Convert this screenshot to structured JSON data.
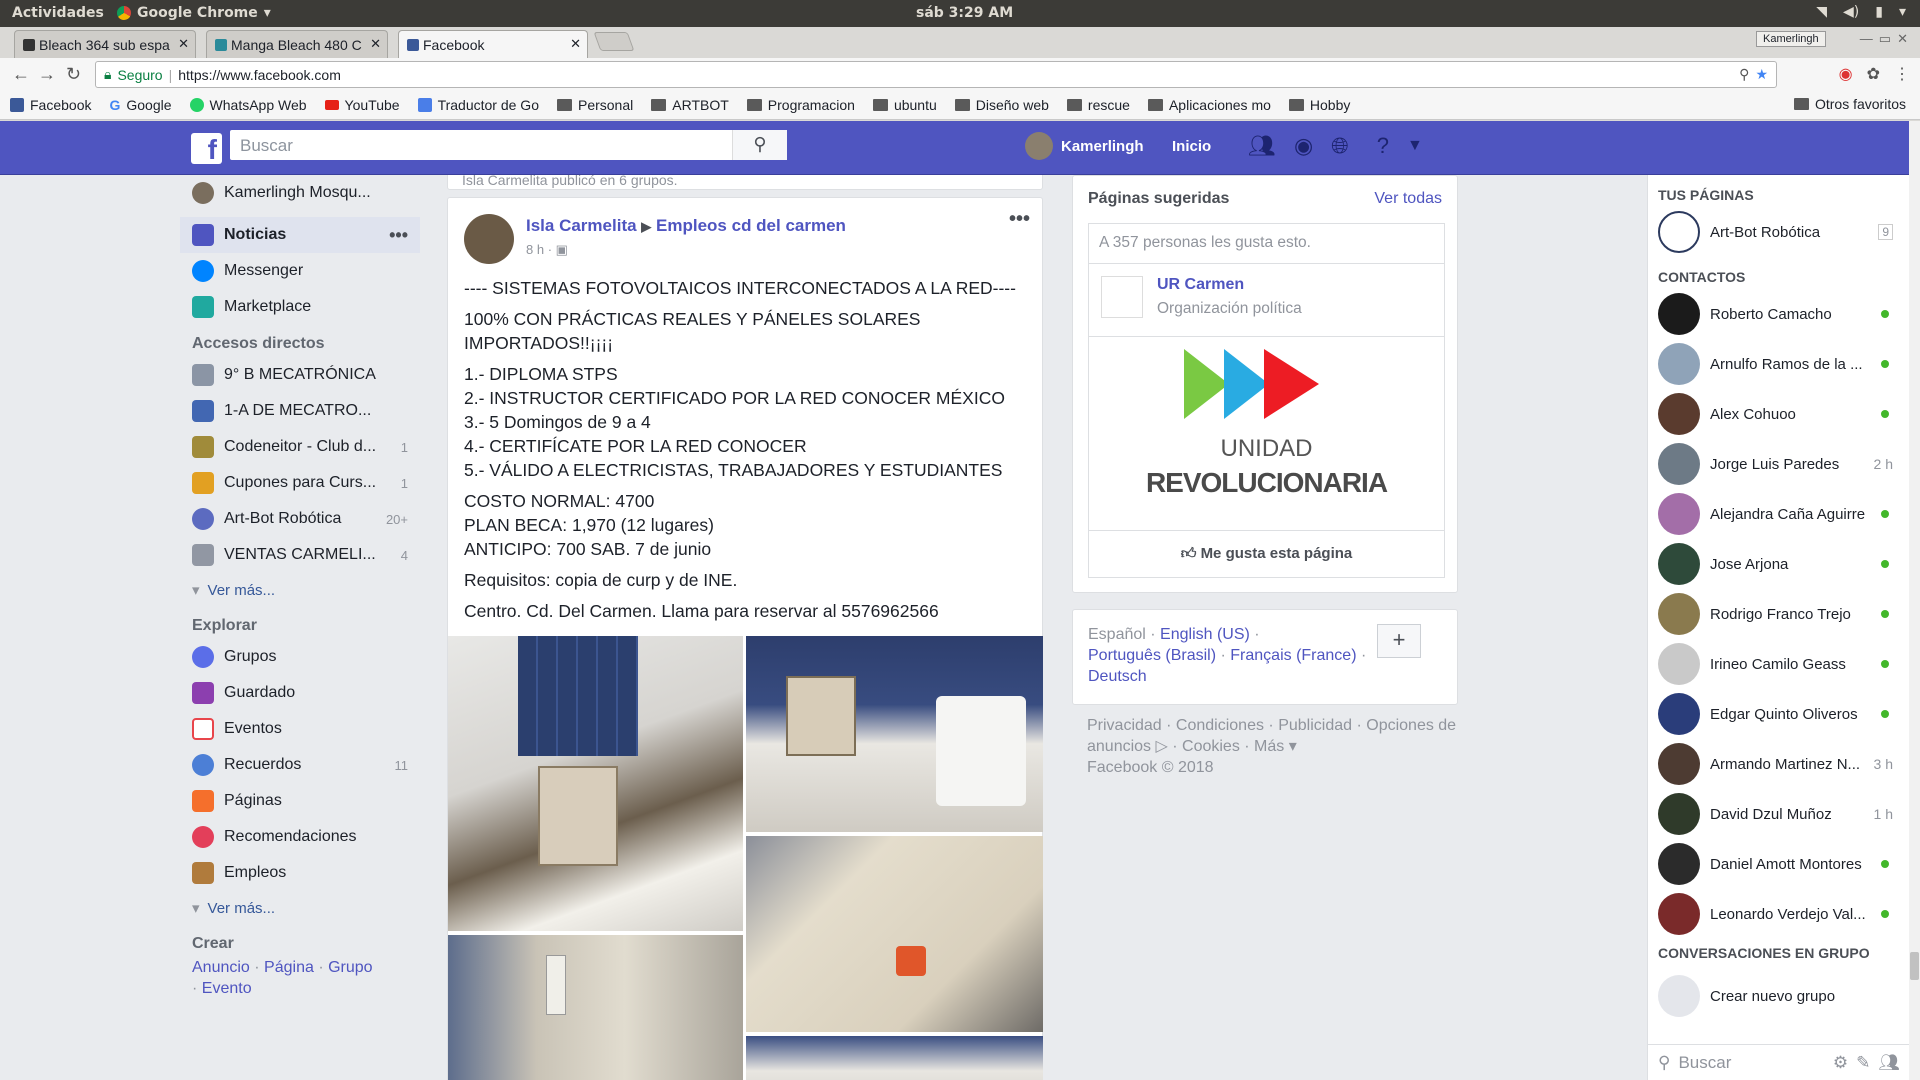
{
  "system": {
    "activities": "Actividades",
    "app": "Google Chrome",
    "clock": "sáb  3:29 AM"
  },
  "tabs": [
    {
      "label": "Bleach 364 sub espa",
      "active": false
    },
    {
      "label": "Manga Bleach 480 C",
      "active": false
    },
    {
      "label": "Facebook",
      "active": true
    }
  ],
  "profile": "Kamerlingh",
  "omnibox": {
    "secure": "Seguro",
    "url": "https://www.facebook.com"
  },
  "bookmarks": [
    "Facebook",
    "Google",
    "WhatsApp Web",
    "YouTube",
    "Traductor de Go",
    "Personal",
    "ARTBOT",
    "Programacion",
    "ubuntu",
    "Diseño web",
    "rescue",
    "Aplicaciones mo",
    "Hobby"
  ],
  "bookmarks_other": "Otros favoritos",
  "fb": {
    "search_placeholder": "Buscar",
    "user": "Kamerlingh",
    "home": "Inicio",
    "left": {
      "profile": "Kamerlingh Mosqu...",
      "news": "Noticias",
      "messenger": "Messenger",
      "marketplace": "Marketplace",
      "shortcuts_title": "Accesos directos",
      "shortcuts": [
        {
          "label": "9° B MECATRÓNICA",
          "count": ""
        },
        {
          "label": "1-A DE MECATRO...",
          "count": ""
        },
        {
          "label": "Codeneitor - Club d...",
          "count": "1"
        },
        {
          "label": "Cupones para Curs...",
          "count": "1"
        },
        {
          "label": "Art-Bot Robótica",
          "count": "20+"
        },
        {
          "label": "VENTAS CARMELI...",
          "count": "4"
        }
      ],
      "more": "Ver más...",
      "explore_title": "Explorar",
      "explore": [
        {
          "label": "Grupos",
          "count": ""
        },
        {
          "label": "Guardado",
          "count": ""
        },
        {
          "label": "Eventos",
          "count": ""
        },
        {
          "label": "Recuerdos",
          "count": "11"
        },
        {
          "label": "Páginas",
          "count": ""
        },
        {
          "label": "Recomendaciones",
          "count": ""
        },
        {
          "label": "Empleos",
          "count": ""
        }
      ],
      "more2": "Ver más...",
      "create_title": "Crear",
      "create": [
        "Anuncio",
        "Página",
        "Grupo",
        "Evento"
      ]
    },
    "post": {
      "prev_line": "Isla Carmelita publicó en 6 grupos.",
      "author": "Isla Carmelita",
      "group": "Empleos cd del carmen",
      "time": "8 h",
      "lines": [
        "---- SISTEMAS FOTOVOLTAICOS INTERCONECTADOS A LA RED----",
        "100% CON PRÁCTICAS REALES Y PÁNELES SOLARES IMPORTADOS!!¡¡¡¡",
        "1.- DIPLOMA STPS\n2.- INSTRUCTOR CERTIFICADO POR LA RED CONOCER MÉXICO\n3.- 5 Domingos de 9 a 4\n4.- CERTIFÍCATE POR LA RED CONOCER\n5.- VÁLIDO A ELECTRICISTAS, TRABAJADORES Y ESTUDIANTES",
        "COSTO NORMAL: 4700\nPLAN BECA: 1,970 (12 lugares)\nANTICIPO: 700 SAB. 7 de junio",
        "Requisitos: copia de curp y de INE.",
        "Centro. Cd. Del Carmen. Llama para reservar al 5576962566"
      ]
    },
    "right": {
      "sugg_title": "Páginas sugeridas",
      "see_all": "Ver todas",
      "likes": "A 357 personas les gusta esto.",
      "page_name": "UR Carmen",
      "page_cat": "Organización política",
      "banner1": "UNIDAD",
      "banner2": "REVOLUCIONARIA",
      "like_btn": "Me gusta esta página",
      "langs": [
        "Español",
        "English (US)",
        "Português (Brasil)",
        "Français (France)",
        "Deutsch"
      ],
      "footer": "Privacidad · Condiciones · Publicidad · Opciones de anuncios ▷ · Cookies · Más ▾",
      "copyright": "Facebook © 2018"
    },
    "chat": {
      "pages_title": "TUS PÁGINAS",
      "page": {
        "name": "Art-Bot Robótica",
        "count": "9"
      },
      "contacts_title": "CONTACTOS",
      "contacts": [
        {
          "name": "Roberto Camacho",
          "status": ""
        },
        {
          "name": "Arnulfo Ramos de la ...",
          "status": ""
        },
        {
          "name": "Alex Cohuoo",
          "status": ""
        },
        {
          "name": "Jorge Luis Paredes",
          "status": "2 h"
        },
        {
          "name": "Alejandra Caña Aguirre",
          "status": ""
        },
        {
          "name": "Jose Arjona",
          "status": ""
        },
        {
          "name": "Rodrigo Franco Trejo",
          "status": ""
        },
        {
          "name": "Irineo Camilo Geass",
          "status": ""
        },
        {
          "name": "Edgar Quinto Oliveros",
          "status": ""
        },
        {
          "name": "Armando Martinez N...",
          "status": "3 h"
        },
        {
          "name": "David Dzul Muñoz",
          "status": "1 h"
        },
        {
          "name": "Daniel Amott Montores",
          "status": ""
        },
        {
          "name": "Leonardo Verdejo Val...",
          "status": ""
        }
      ],
      "groups_title": "CONVERSACIONES EN GRUPO",
      "new_group": "Crear nuevo grupo",
      "search": "Buscar"
    }
  }
}
